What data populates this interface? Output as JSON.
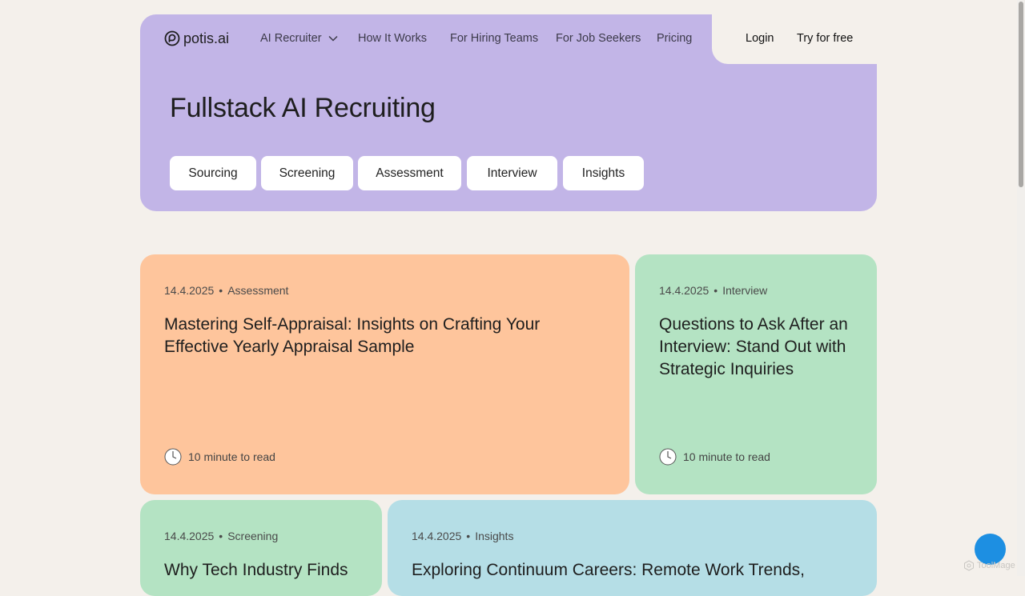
{
  "brand": {
    "name": "potis.ai"
  },
  "nav": {
    "items": [
      {
        "label": "AI Recruiter",
        "has_dropdown": true
      },
      {
        "label": "How It Works"
      },
      {
        "label": "For Hiring Teams"
      },
      {
        "label": "For Job Seekers"
      },
      {
        "label": "Pricing"
      }
    ],
    "login": "Login",
    "try_free": "Try for free"
  },
  "hero": {
    "title": "Fullstack AI Recruiting",
    "pills": [
      "Sourcing",
      "Screening",
      "Assessment",
      "Interview",
      "Insights"
    ]
  },
  "cards": [
    {
      "date": "14.4.2025",
      "category": "Assessment",
      "title": "Mastering Self-Appraisal: Insights on Crafting Your Effective Yearly Appraisal Sample",
      "read_time": "10 minute to read",
      "color": "#fec59c"
    },
    {
      "date": "14.4.2025",
      "category": "Interview",
      "title": "Questions to Ask After an Interview: Stand Out with Strategic Inquiries",
      "read_time": "10 minute to read",
      "color": "#b4e3c3"
    },
    {
      "date": "14.4.2025",
      "category": "Screening",
      "title": "Why Tech Industry Finds",
      "read_time": "",
      "color": "#b4e3c3"
    },
    {
      "date": "14.4.2025",
      "category": "Insights",
      "title": "Exploring Continuum Careers: Remote Work Trends,",
      "read_time": "",
      "color": "#b5dee6"
    }
  ],
  "colors": {
    "hero_bg": "#c2b5e7",
    "page_bg": "#f4f0eb",
    "fab": "#1d8fe2"
  },
  "watermark": {
    "text": "ToolMage"
  }
}
